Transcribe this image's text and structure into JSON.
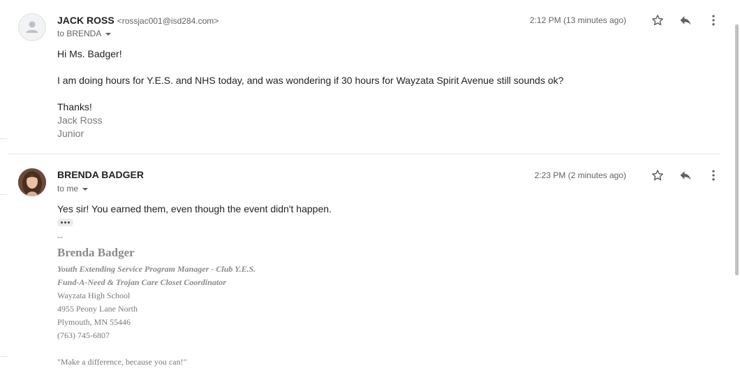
{
  "messages": [
    {
      "sender_name": "JACK ROSS",
      "sender_email": "<rossjac001@isd284.com>",
      "to_label": "to BRENDA",
      "time": "2:12 PM (13 minutes ago)",
      "greeting": "Hi Ms. Badger!",
      "body": "I am doing hours for Y.E.S. and NHS today, and was wondering if 30 hours for Wayzata Spirit Avenue still sounds ok?",
      "closing": "Thanks!",
      "signature_name": "Jack Ross",
      "signature_role": "Junior"
    },
    {
      "sender_name": "BRENDA BADGER",
      "to_label": "to me",
      "time": "2:23 PM (2 minutes ago)",
      "body": "Yes sir!  You earned them, even though the event didn't happen.",
      "signature": {
        "separator": "--",
        "name": "Brenda Badger",
        "title1": "Youth Extending Service Program Manager - Club Y.E.S.",
        "title2": "Fund-A-Need & Trojan Care Closet Coordinator",
        "school": "Wayzata High School",
        "address": "4955 Peony Lane North",
        "city": "Plymouth,  MN  55446",
        "phone": "(763) 745-6807",
        "quote": "\"Make a difference, because you can!\""
      }
    }
  ],
  "icons": {
    "star": "star-icon",
    "reply": "reply-icon",
    "more": "more-vert-icon",
    "avatar_default": "person-icon",
    "expand": "show-trimmed-content-icon"
  },
  "colors": {
    "text": "#222222",
    "secondary": "#5f6368",
    "signature_gray": "#8a8a8a"
  }
}
